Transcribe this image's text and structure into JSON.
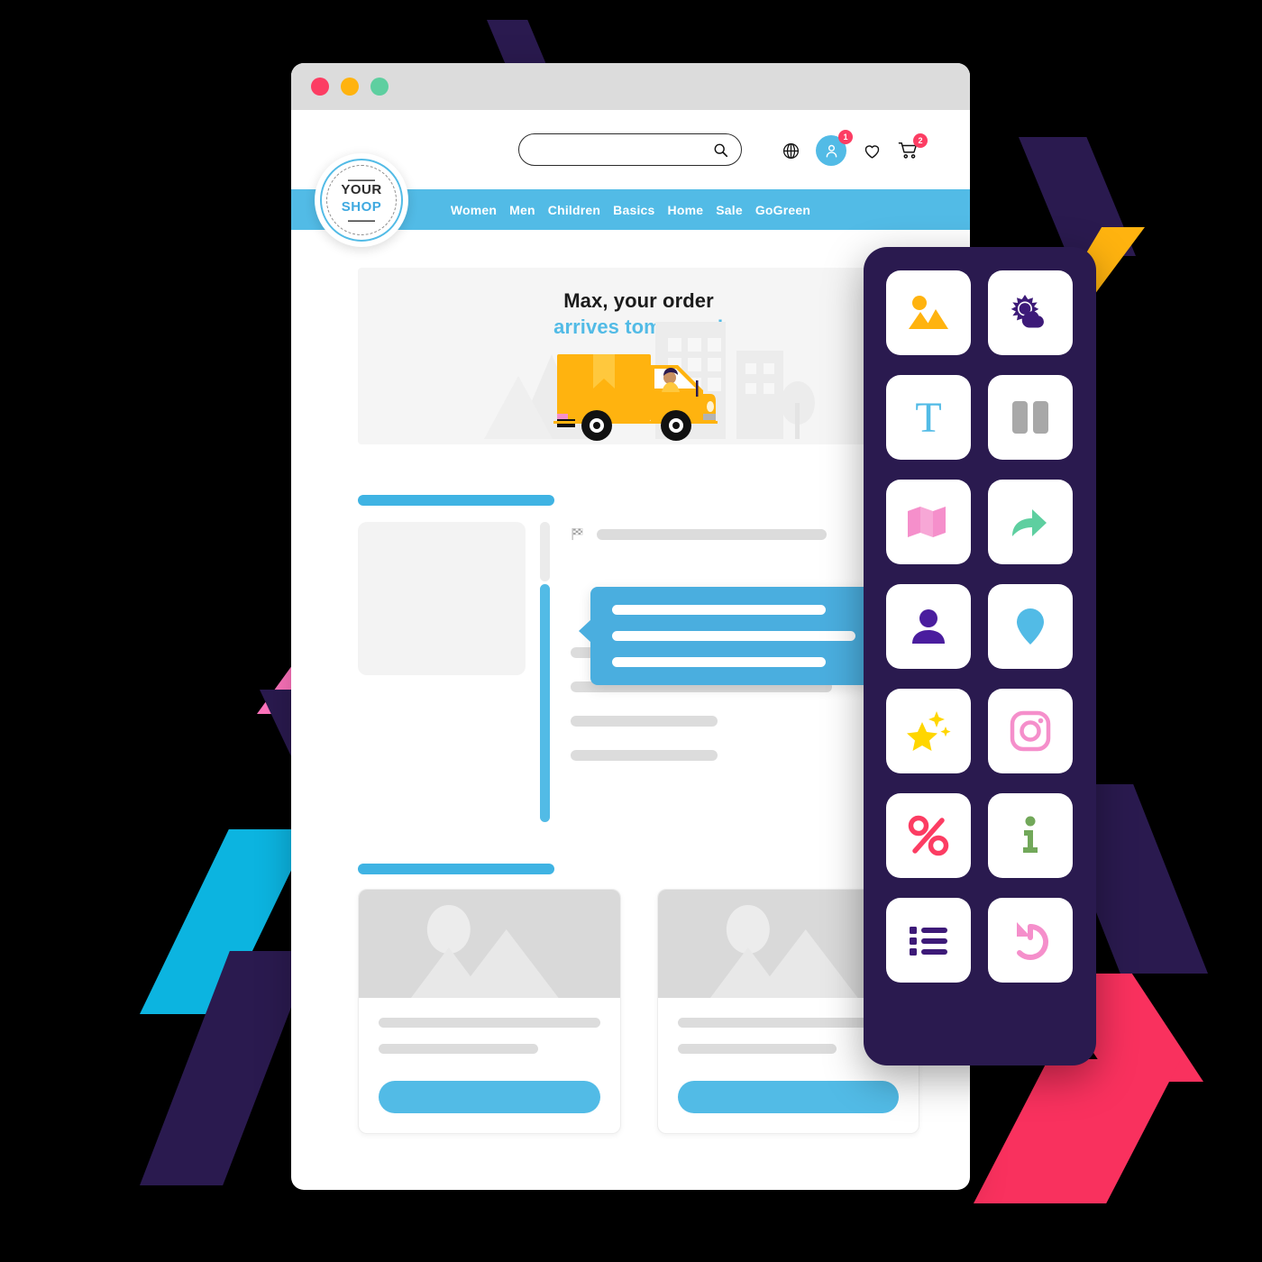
{
  "window": {
    "traffic_lights": [
      "close",
      "minimize",
      "maximize"
    ],
    "colors": {
      "close": "#fc3d63",
      "minimize": "#ffb30f",
      "maximize": "#5ecfa0"
    }
  },
  "brand": {
    "logo_line1": "YOUR",
    "logo_line2": "SHOP",
    "accent": "#52bbe6"
  },
  "search": {
    "value": "",
    "placeholder": "",
    "icon": "search-icon"
  },
  "header_icons": [
    {
      "name": "globe-icon",
      "badge": ""
    },
    {
      "name": "user-account-icon",
      "badge": "1"
    },
    {
      "name": "heart-wishlist-icon",
      "badge": ""
    },
    {
      "name": "shopping-cart-icon",
      "badge": "2"
    }
  ],
  "nav": {
    "items": [
      {
        "label": "Women"
      },
      {
        "label": "Men"
      },
      {
        "label": "Children"
      },
      {
        "label": "Basics"
      },
      {
        "label": "Home"
      },
      {
        "label": "Sale"
      },
      {
        "label": "GoGreen"
      }
    ]
  },
  "hero": {
    "headline": "Max, your order",
    "subheadline": "arrives tomorrow!",
    "illustration": "delivery-truck-illustration",
    "truck_color": "#ffb30f"
  },
  "content": {
    "section1_heading_bar": "",
    "flag_icon": "checkered-flag-icon",
    "tooltip_lines": [
      "",
      "",
      ""
    ],
    "text_lines": [
      "",
      "",
      "",
      ""
    ]
  },
  "cards": [
    {
      "image": "image-placeholder",
      "line1": "",
      "line2": "",
      "button_label": ""
    },
    {
      "image": "image-placeholder",
      "line1": "",
      "line2": "",
      "button_label": ""
    }
  ],
  "icon_panel": {
    "background": "#2a1a4f",
    "tiles": [
      {
        "name": "image-icon",
        "label": "Image",
        "color": "#ffb30f"
      },
      {
        "name": "weather-icon",
        "label": "Weather",
        "color": "#3d1a78"
      },
      {
        "name": "text-icon",
        "label": "Text",
        "color": "#52bbe6"
      },
      {
        "name": "columns-icon",
        "label": "Columns",
        "color": "#a8a8a8"
      },
      {
        "name": "map-icon",
        "label": "Map",
        "color": "#f58fcb"
      },
      {
        "name": "share-icon",
        "label": "Share",
        "color": "#5ecfa0"
      },
      {
        "name": "person-icon",
        "label": "Person",
        "color": "#4a1d9e"
      },
      {
        "name": "location-pin-icon",
        "label": "Location",
        "color": "#52bbe6"
      },
      {
        "name": "sparkle-star-icon",
        "label": "Highlight",
        "color": "#ffd600"
      },
      {
        "name": "instagram-icon",
        "label": "Instagram",
        "color": "#f58fcb"
      },
      {
        "name": "percent-icon",
        "label": "Discount",
        "color": "#fc3d63"
      },
      {
        "name": "info-icon",
        "label": "Info",
        "color": "#72a85a"
      },
      {
        "name": "list-icon",
        "label": "List",
        "color": "#3d1a78"
      },
      {
        "name": "undo-icon",
        "label": "Undo",
        "color": "#f58fcb"
      }
    ]
  },
  "decorations": {
    "chevron_colors": [
      "#2a1a4f",
      "#0ec88f",
      "#ffb30f",
      "#ff74bd",
      "#0cb4e0",
      "#f9315e"
    ]
  }
}
